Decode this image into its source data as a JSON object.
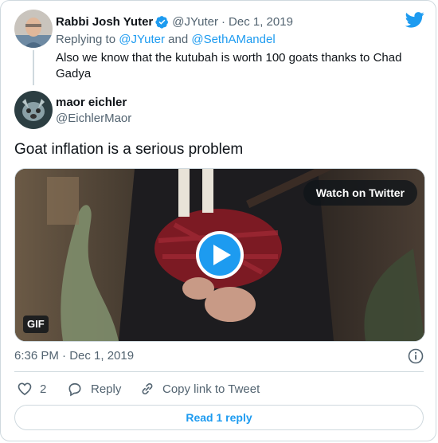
{
  "parent_tweet": {
    "author_name": "Rabbi Josh Yuter",
    "handle": "@JYuter",
    "date_sep": "·",
    "date": "Dec 1, 2019",
    "replying_prefix": "Replying to",
    "replying_user1": "@JYuter",
    "replying_and": "and",
    "replying_user2": "@SethAMandel",
    "text": "Also we know that the kutubah is worth 100 goats thanks to Chad Gadya"
  },
  "main_tweet": {
    "author_name": "maor eichler",
    "handle": "@EichlerMaor",
    "text": "Goat inflation is a serious problem",
    "media": {
      "watch_label": "Watch on Twitter",
      "gif_label": "GIF"
    },
    "timestamp": "6:36 PM · Dec 1, 2019"
  },
  "actions": {
    "like_count": "2",
    "reply_label": "Reply",
    "copy_label": "Copy link to Tweet"
  },
  "read_reply_label": "Read 1 reply",
  "colors": {
    "accent": "#1d9bf0",
    "text": "#0f1419",
    "muted": "#536471",
    "border": "#cfd9de"
  },
  "icons": {
    "brand": "twitter-bird-icon",
    "verified": "verified-badge-icon",
    "info": "info-icon",
    "like": "heart-icon",
    "reply": "comment-icon",
    "copy": "link-icon",
    "play": "play-icon"
  }
}
